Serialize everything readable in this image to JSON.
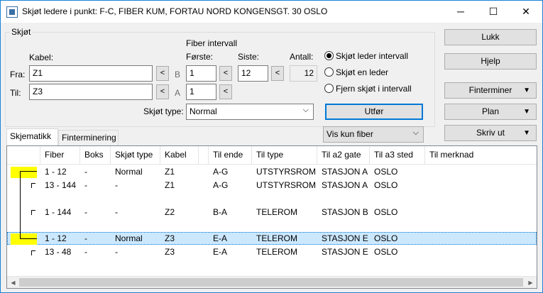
{
  "window": {
    "title": "Skjøt ledere i punkt: F-C, FIBER KUM, FORTAU NORD KONGENSGT. 30 OSLO",
    "minimize": "─",
    "maximize": "☐",
    "close": "✕"
  },
  "group": {
    "title": "Skjøt",
    "kabel_label": "Kabel:",
    "fra_label": "Fra:",
    "til_label": "Til:",
    "fra_value": "Z1",
    "til_value": "Z3",
    "fra_pick": "<",
    "til_pick": "<",
    "b_label": "B",
    "a_label": "A",
    "fiber_interval_label": "Fiber intervall",
    "forste_label": "Første:",
    "siste_label": "Siste:",
    "antall_label": "Antall:",
    "fra_forste": "1",
    "fra_forste_pick": "<",
    "fra_siste": "12",
    "fra_siste_pick": "<",
    "antall": "12",
    "til_forste": "1",
    "til_forste_pick": "<",
    "skjot_type_label": "Skjøt type:",
    "skjot_type_value": "Normal"
  },
  "radios": [
    {
      "label": "Skjøt leder intervall",
      "checked": true
    },
    {
      "label": "Skjøt en leder",
      "checked": false
    },
    {
      "label": "Fjern skjøt i intervall",
      "checked": false
    }
  ],
  "buttons": {
    "utfor": "Utfør",
    "lukk": "Lukk",
    "hjelp": "Hjelp",
    "finterminer": "Finterminer",
    "plan": "Plan",
    "skriv_ut": "Skriv ut",
    "arrow": "▼"
  },
  "filter": {
    "value": "Vis kun fiber",
    "chev": "⌵"
  },
  "tabs": [
    "Skjematikk",
    "Finterminering"
  ],
  "grid": {
    "columns": [
      "Fiber",
      "Boks",
      "Skjøt type",
      "Kabel",
      "Til ende",
      "Til type",
      "Til a2 gate",
      "Til a3 sted",
      "Til merknad"
    ],
    "rows": [
      [
        "1 - 12",
        "-",
        "Normal",
        "Z1",
        "A-G",
        "UTSTYRSROM",
        "STASJON A",
        "OSLO",
        ""
      ],
      [
        "13 - 144",
        "-",
        "-",
        "Z1",
        "A-G",
        "UTSTYRSROM",
        "STASJON A",
        "OSLO",
        ""
      ],
      [
        "1 - 144",
        "-",
        "-",
        "Z2",
        "B-A",
        "TELEROM",
        "STASJON B",
        "OSLO",
        ""
      ],
      [
        "1 - 12",
        "-",
        "Normal",
        "Z3",
        "E-A",
        "TELEROM",
        "STASJON E",
        "OSLO",
        ""
      ],
      [
        "13 - 48",
        "-",
        "-",
        "Z3",
        "E-A",
        "TELEROM",
        "STASJON E",
        "OSLO",
        ""
      ]
    ],
    "scroll_left": "◀",
    "scroll_right": "▶"
  }
}
